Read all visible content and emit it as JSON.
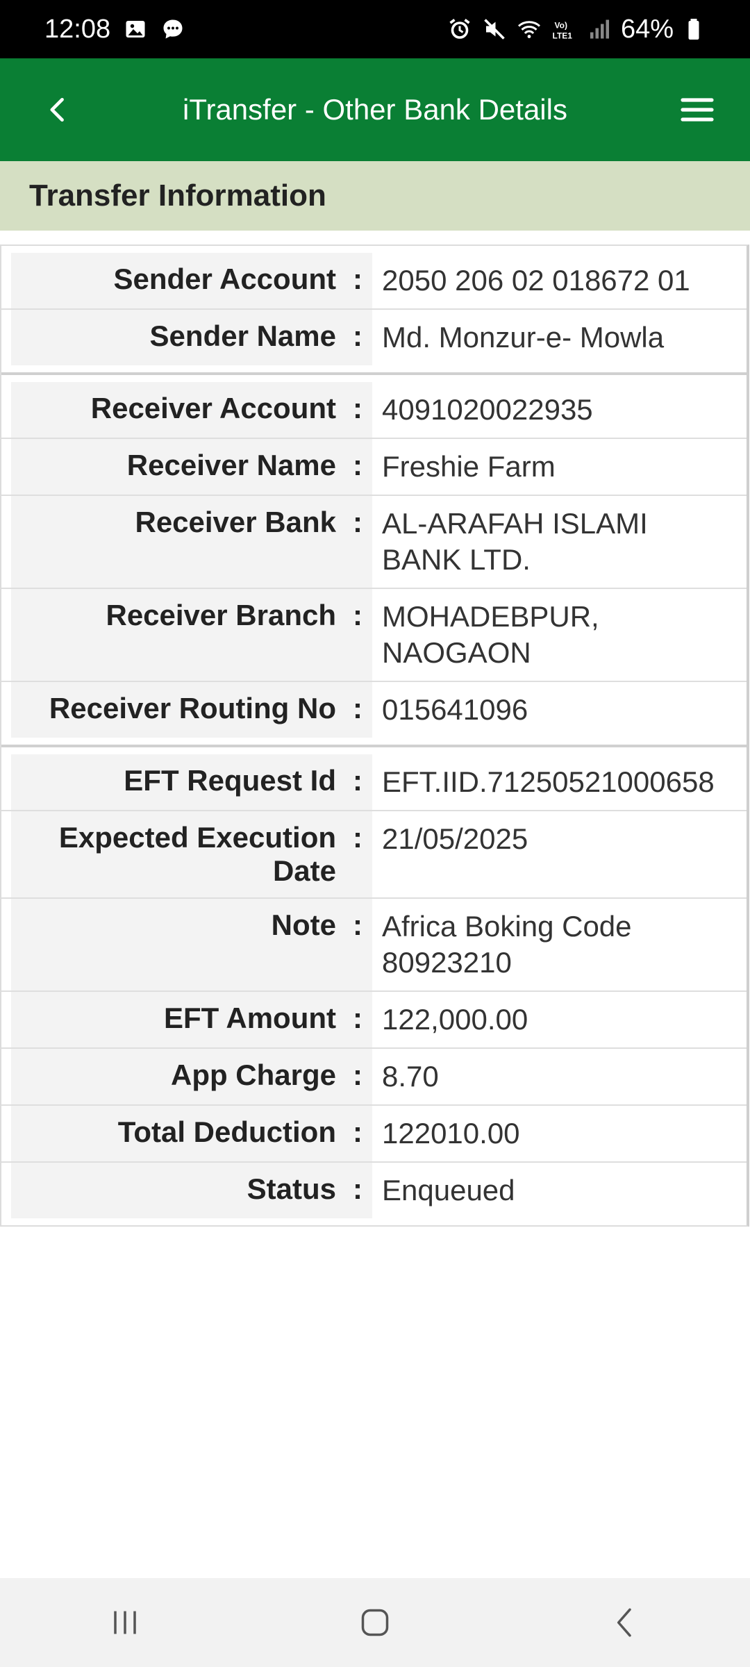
{
  "status_bar": {
    "time": "12:08",
    "battery": "64%",
    "left_icons": [
      "gallery-icon",
      "chat-icon"
    ],
    "right_icons": [
      "alarm-icon",
      "mute-icon",
      "wifi-icon",
      "volte-icon",
      "signal-icon",
      "battery-icon"
    ]
  },
  "app_bar": {
    "title": "iTransfer - Other Bank Details",
    "back_icon": "chevron-left-icon",
    "menu_icon": "hamburger-menu-icon",
    "color": "#0a7f34"
  },
  "section": {
    "title": "Transfer Information"
  },
  "groups": [
    {
      "rows": [
        {
          "label": "Sender Account",
          "value": "2050 206 02 018672 01"
        },
        {
          "label": "Sender Name",
          "value": "Md. Monzur-e- Mowla"
        }
      ]
    },
    {
      "rows": [
        {
          "label": "Receiver Account",
          "value": "4091020022935"
        },
        {
          "label": "Receiver Name",
          "value": "Freshie Farm"
        },
        {
          "label": "Receiver Bank",
          "value": "AL-ARAFAH ISLAMI BANK LTD."
        },
        {
          "label": "Receiver Branch",
          "value": "MOHADEBPUR, NAOGAON"
        },
        {
          "label": "Receiver Routing No",
          "value": "015641096"
        }
      ]
    },
    {
      "rows": [
        {
          "label": "EFT Request Id",
          "value": "EFT.IID.71250521000658"
        },
        {
          "label": "Expected Execution Date",
          "value": "21/05/2025"
        },
        {
          "label": "Note",
          "value": "Africa Boking Code 80923210"
        },
        {
          "label": "EFT Amount",
          "value": "122,000.00"
        },
        {
          "label": "App Charge",
          "value": "8.70"
        },
        {
          "label": "Total Deduction",
          "value": "122010.00"
        },
        {
          "label": "Status",
          "value": "Enqueued"
        }
      ]
    }
  ],
  "separator": ":",
  "nav_bar": {
    "buttons": [
      "recent-apps-icon",
      "home-icon",
      "back-icon"
    ]
  }
}
